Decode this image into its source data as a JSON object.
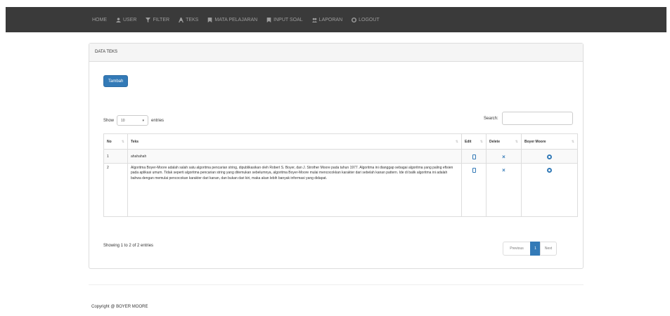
{
  "nav": {
    "items": [
      {
        "label": "HOME",
        "icon": ""
      },
      {
        "label": "USER",
        "icon": "user-icon"
      },
      {
        "label": "FILTER",
        "icon": "filter-icon"
      },
      {
        "label": "TEKS",
        "icon": "text-icon"
      },
      {
        "label": "MATA PELAJARAN",
        "icon": "bookmark-icon"
      },
      {
        "label": "INPUT SOAL",
        "icon": "bookmark-icon"
      },
      {
        "label": "LAPORAN",
        "icon": "users-icon"
      },
      {
        "label": "LOGOUT",
        "icon": "logout-icon"
      }
    ]
  },
  "panel": {
    "title": "DATA TEKS",
    "add_button": "Tambah"
  },
  "controls": {
    "show_label": "Show",
    "entries_value": "10",
    "entries_label": "entries",
    "search_label": "Search:"
  },
  "table": {
    "headers": [
      "No",
      "Teks",
      "Edit",
      "Delete",
      "Boyer Moore"
    ],
    "rows": [
      {
        "no": "1",
        "teks": "ahahahah"
      },
      {
        "no": "2",
        "teks": "Algoritma Boyer-Moore adalah salah satu algoritma pencarian string, dipublikasikan oleh Robert S. Boyer, dan J. Strother Moore pada tahun 1977. Algoritma ini dianggap sebagai algoritma yang paling efisien pada aplikasi umum. Tidak seperti algoritma pencarian string yang ditemukan sebelumnya, algoritma Boyer-Moore mulai mencocokkan karakter dari sebelah kanan pattern. Ide di balik algoritma ini adalah bahwa dengan memulai pencocokan karakter dari kanan, dan bukan dari kiri, maka akan lebih banyak informasi yang didapat."
      }
    ]
  },
  "footer_info": "Showing 1 to 2 of 2 entries",
  "pagination": {
    "previous": "Previous",
    "current": "1",
    "next": "Next"
  },
  "copyright": "Copyright @ BOYER MOORE",
  "colors": {
    "navbar": "#3a3a3a",
    "primary": "#337ab7"
  }
}
